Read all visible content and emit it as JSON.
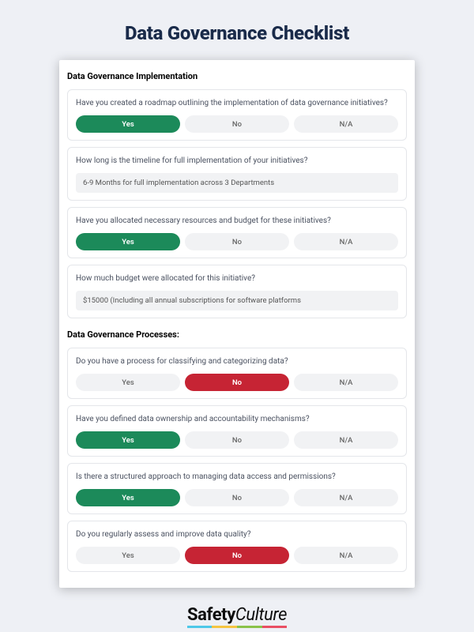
{
  "title": "Data Governance Checklist",
  "sections": [
    {
      "heading": "Data Governance Implementation",
      "items": [
        {
          "type": "choice",
          "question": "Have you created a roadmap outlining the implementation of data governance initiatives?",
          "options": [
            "Yes",
            "No",
            "N/A"
          ],
          "selected": 0,
          "selectedStyle": "green"
        },
        {
          "type": "text",
          "question": "How long is the timeline for full implementation of your initiatives?",
          "answer": "6-9 Months for full implementation across 3 Departments"
        },
        {
          "type": "choice",
          "question": "Have you allocated necessary resources and budget for these initiatives?",
          "options": [
            "Yes",
            "No",
            "N/A"
          ],
          "selected": 0,
          "selectedStyle": "green"
        },
        {
          "type": "text",
          "question": "How much budget were allocated for this initiative?",
          "answer": "$15000 (Including all annual subscriptions for software platforms"
        }
      ]
    },
    {
      "heading": "Data Governance Processes:",
      "items": [
        {
          "type": "choice",
          "question": "Do you have a process for classifying and categorizing data?",
          "options": [
            "Yes",
            "No",
            "N/A"
          ],
          "selected": 1,
          "selectedStyle": "red"
        },
        {
          "type": "choice",
          "question": "Have you defined data ownership and accountability mechanisms?",
          "options": [
            "Yes",
            "No",
            "N/A"
          ],
          "selected": 0,
          "selectedStyle": "green"
        },
        {
          "type": "choice",
          "question": "Is there a structured approach to managing data access and permissions?",
          "options": [
            "Yes",
            "No",
            "N/A"
          ],
          "selected": 0,
          "selectedStyle": "green"
        },
        {
          "type": "choice",
          "question": "Do you regularly assess and improve data quality?",
          "options": [
            "Yes",
            "No",
            "N/A"
          ],
          "selected": 1,
          "selectedStyle": "red"
        }
      ]
    }
  ],
  "brand": {
    "bold": "Safety",
    "light": "Culture"
  }
}
